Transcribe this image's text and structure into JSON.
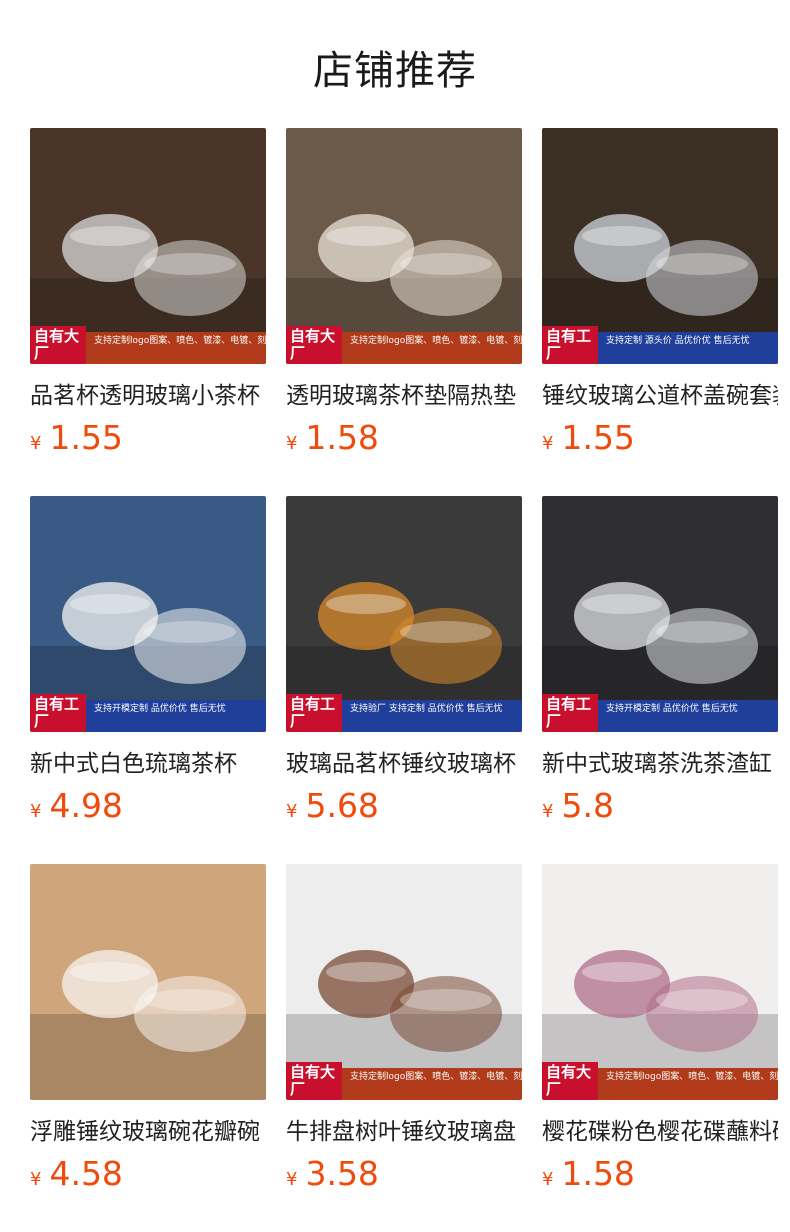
{
  "section_title": "店铺推荐",
  "products": [
    {
      "name": "品茗杯透明玻璃小茶杯",
      "currency": "¥",
      "price": "1.55",
      "badge": "自有大厂",
      "banner": "支持定制logo图案、喷色、镀漆、电镀、刻花、贴钻等后加工、包装",
      "banner_color": "#b03a1a",
      "bg": "#4a3528",
      "accent": "#d9d9d9"
    },
    {
      "name": "透明玻璃茶杯垫隔热垫",
      "currency": "¥",
      "price": "1.58",
      "badge": "自有大厂",
      "banner": "支持定制logo图案、喷色、镀漆、电镀、刻花、贴钻等后加工、包装",
      "banner_color": "#b03a1a",
      "bg": "#6b5a4a",
      "accent": "#e8e2d6"
    },
    {
      "name": "锤纹玻璃公道杯盖碗套装",
      "currency": "¥",
      "price": "1.55",
      "badge": "自有工厂",
      "banner": "支持定制 源头价 品优价优 售后无忧",
      "banner_color": "#1f3f9a",
      "bg": "#3c2f24",
      "accent": "#cfd6dc"
    },
    {
      "name": "新中式白色琉璃茶杯",
      "currency": "¥",
      "price": "4.98",
      "badge": "自有工厂",
      "banner": "支持开模定制 品优价优 售后无忧",
      "banner_color": "#1f3f9a",
      "bg": "#3a5a86",
      "accent": "#f4f4f2"
    },
    {
      "name": "玻璃品茗杯锤纹玻璃杯",
      "currency": "¥",
      "price": "5.68",
      "badge": "自有工厂",
      "banner": "支持验厂 支持定制 品优价优 售后无忧",
      "banner_color": "#1f3f9a",
      "bg": "#3b3a3a",
      "accent": "#d98a2a"
    },
    {
      "name": "新中式玻璃茶洗茶渣缸",
      "currency": "¥",
      "price": "5.8",
      "badge": "自有工厂",
      "banner": "支持开模定制 品优价优 售后无忧",
      "banner_color": "#1f3f9a",
      "bg": "#2f2f33",
      "accent": "#dfe2e5"
    },
    {
      "name": "浮雕锤纹玻璃碗花瓣碗",
      "currency": "¥",
      "price": "4.58",
      "badge": "",
      "banner": "",
      "banner_color": "#b03a1a",
      "bg": "#cfa57c",
      "accent": "#f7f3ee"
    },
    {
      "name": "牛排盘树叶锤纹玻璃盘",
      "currency": "¥",
      "price": "3.58",
      "badge": "自有大厂",
      "banner": "支持定制logo图案、喷色、镀漆、电镀、刻花、贴钻等后加工、包装",
      "banner_color": "#b03a1a",
      "bg": "#ededed",
      "accent": "#7a4a35"
    },
    {
      "name": "樱花碟粉色樱花碟蘸料碟",
      "currency": "¥",
      "price": "1.58",
      "badge": "自有大厂",
      "banner": "支持定制logo图案、喷色、镀漆、电镀、刻花、贴钻等后加工、包装",
      "banner_color": "#b03a1a",
      "bg": "#f1eeee",
      "accent": "#b06f8a"
    }
  ]
}
